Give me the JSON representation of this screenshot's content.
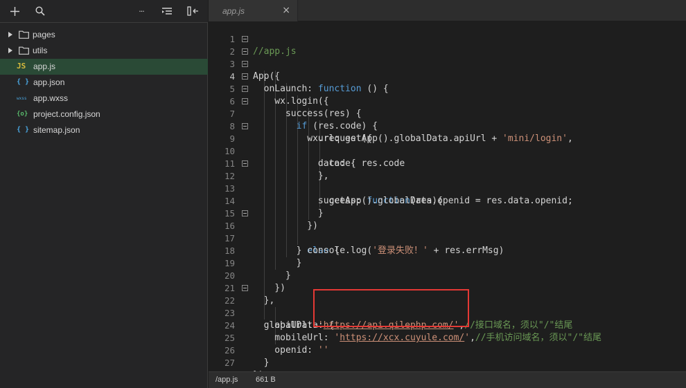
{
  "toolbar": {
    "add_icon": "plus-icon",
    "search_icon": "search-icon",
    "more_label": "···",
    "collapse_icon": "collapse-icon",
    "split_icon": "split-icon"
  },
  "tree": [
    {
      "type": "folder",
      "label": "pages",
      "icon": "folder-icon"
    },
    {
      "type": "folder",
      "label": "utils",
      "icon": "folder-icon"
    },
    {
      "type": "file",
      "label": "app.js",
      "icon_text": "JS",
      "active": true
    },
    {
      "type": "file",
      "label": "app.json",
      "icon_text": "{ }"
    },
    {
      "type": "file",
      "label": "app.wxss",
      "icon_text": "wxss"
    },
    {
      "type": "file",
      "label": "project.config.json",
      "icon_text": "{o}"
    },
    {
      "type": "file",
      "label": "sitemap.json",
      "icon_text": "{ }"
    }
  ],
  "tab": {
    "label": "app.js",
    "close": "×"
  },
  "code": {
    "line_numbers": [
      "1",
      "2",
      "3",
      "4",
      "5",
      "6",
      "7",
      "8",
      "9",
      "10",
      "11",
      "12",
      "13",
      "14",
      "15",
      "16",
      "17",
      "18",
      "19",
      "20",
      "21",
      "22",
      "23",
      "24",
      "25",
      "26",
      "27"
    ],
    "current_line": "4",
    "l1": "//app.js",
    "l2": "App({",
    "l3a": "  onLaunch: ",
    "l3b": "function",
    "l3c": " () {",
    "l4": "    wx.login({",
    "l5": "      success(res) {",
    "l6a": "        ",
    "l6b": "if",
    "l6c": " (res.code) {",
    "l7": "          wx.request({",
    "l8a": "            url: getApp().globalData.apiUrl + ",
    "l8b": "'mini/login'",
    "l8c": ",",
    "l9": "            data: {",
    "l10": "              code: res.code",
    "l11": "            },",
    "l12a": "            success: ",
    "l12b": "function",
    "l12c": "(res){",
    "l13": "              getApp().globalData.openid = res.data.openid;",
    "l14": "            }",
    "l15": "          })",
    "l16a": "        } ",
    "l16b": "else",
    "l16c": " {",
    "l17a": "          console.log(",
    "l17b": "'登录失败！'",
    "l17c": " + res.errMsg)",
    "l18": "        }",
    "l19": "      }",
    "l20": "    })",
    "l21": "  },",
    "l22": "  globalData: {",
    "l23a": "    apiUrl: ",
    "l23b": "'",
    "l23c": "https://api.qilephp.com/",
    "l23d": "'",
    "l23e": ",",
    "l23f": "//接口域名，须以\"/\"结尾",
    "l24a": "    mobileUrl: ",
    "l24b": "'",
    "l24c": "https://xcx.cuyule.com/",
    "l24d": "'",
    "l24e": ",",
    "l24f": "//手机访问域名，须以\"/\"结尾",
    "l25a": "    openid: ",
    "l25b": "''",
    "l26": "  }",
    "l27": "})"
  },
  "status": {
    "path": "/app.js",
    "size": "661 B"
  },
  "colors": {
    "keyword": "#569cd6",
    "string": "#ce9178",
    "comment": "#6a9955",
    "highlight": "#e53935",
    "active_row": "#2a4a36"
  }
}
